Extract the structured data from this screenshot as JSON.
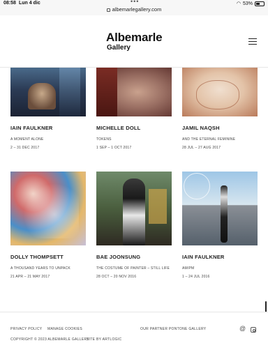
{
  "status": {
    "time": "08:58",
    "date": "Lun 4 dic",
    "battery": "53%",
    "battery_level": 0.53
  },
  "browser": {
    "url": "albemarlegallery.com"
  },
  "header": {
    "logo_main": "Albemarle",
    "logo_sub": "Gallery",
    "menu_icon": "hamburger-icon"
  },
  "exhibitions": [
    {
      "artist": "IAIN FAULKNER",
      "title": "A MOMENT ALONE",
      "dates": "2 – 31 DEC 2017"
    },
    {
      "artist": "MICHELLE DOLL",
      "title": "TOKENS",
      "dates": "1 SEP – 1 OCT 2017"
    },
    {
      "artist": "JAMIL NAQSH",
      "title": "AND THE ETERNAL FEMININE",
      "dates": "28 JUL – 27 AUG 2017"
    },
    {
      "artist": "DOLLY THOMPSETT",
      "title": "A THOUSAND YEARS TO UNPACK",
      "dates": "21 APR – 21 MAY 2017"
    },
    {
      "artist": "BAE JOONSUNG",
      "title": "THE COSTUME OF PAINTER – STILL LIFE",
      "dates": "28 OCT – 20 NOV 2016"
    },
    {
      "artist": "IAIN FAULKNER",
      "title": "AM/PM",
      "dates": "1 – 24 JUL 2016"
    }
  ],
  "footer": {
    "privacy": "PRIVACY POLICY",
    "cookies": "MANAGE COOKIES",
    "partner": "OUR PARTNER PONTONE GALLERY",
    "copyright": "COPYRIGHT © 2023 ALBEMARLE GALLERY",
    "site_by": "SITE BY ARTLOGIC",
    "email_icon": "at-icon",
    "social_icon": "instagram-icon"
  }
}
